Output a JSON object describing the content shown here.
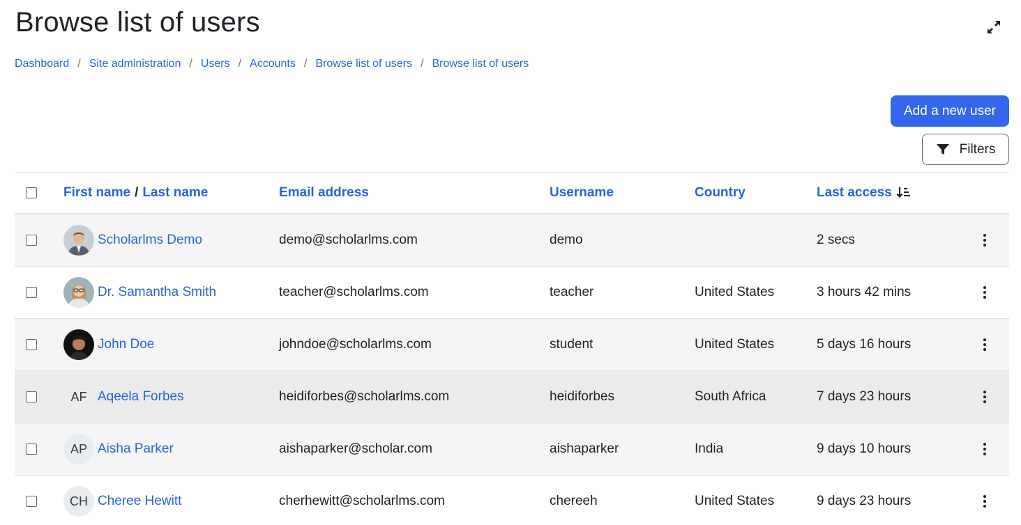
{
  "header": {
    "title": "Browse list of users"
  },
  "breadcrumb": [
    "Dashboard",
    "Site administration",
    "Users",
    "Accounts",
    "Browse list of users",
    "Browse list of users"
  ],
  "actions": {
    "add_user": "Add a new user",
    "filters": "Filters"
  },
  "table": {
    "headers": {
      "first_name": "First name",
      "slash": "/",
      "last_name": "Last name",
      "email": "Email address",
      "username": "Username",
      "country": "Country",
      "last_access": "Last access"
    },
    "rows": [
      {
        "name": "Scholarlms Demo",
        "email": "demo@scholarlms.com",
        "username": "demo",
        "country": "",
        "last_access": "2 secs",
        "avatar": "photo-man-suit"
      },
      {
        "name": "Dr. Samantha Smith",
        "email": "teacher@scholarlms.com",
        "username": "teacher",
        "country": "United States",
        "last_access": "3 hours 42 mins",
        "avatar": "photo-woman-glasses"
      },
      {
        "name": "John Doe",
        "email": "johndoe@scholarlms.com",
        "username": "student",
        "country": "United States",
        "last_access": "5 days 16 hours",
        "avatar": "photo-man-dark"
      },
      {
        "name": "Aqeela Forbes",
        "email": "heidiforbes@scholarlms.com",
        "username": "heidiforbes",
        "country": "South Africa",
        "last_access": "7 days 23 hours",
        "initials": "AF"
      },
      {
        "name": "Aisha Parker",
        "email": "aishaparker@scholar.com",
        "username": "aishaparker",
        "country": "India",
        "last_access": "9 days 10 hours",
        "initials": "AP"
      },
      {
        "name": "Cheree Hewitt",
        "email": "cherhewitt@scholarlms.com",
        "username": "chereeh",
        "country": "United States",
        "last_access": "9 days 23 hours",
        "initials": "CH"
      }
    ]
  },
  "colors": {
    "link": "#2a64d4",
    "primary_button": "#3367ec",
    "row_stripe": "#f5f5f5",
    "row_hover": "#ebebeb"
  },
  "icons": {
    "expand": "expand-icon",
    "filter": "filter-icon",
    "sort": "sort-desc-icon",
    "row_menu": "kebab-menu-icon"
  }
}
